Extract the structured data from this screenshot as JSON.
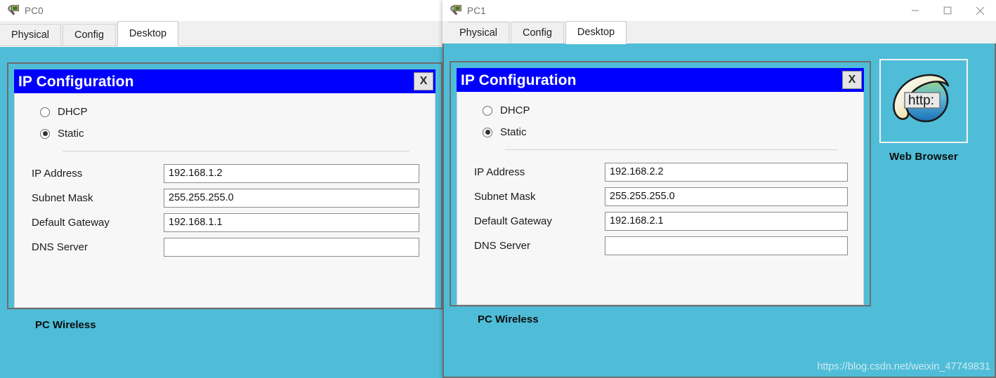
{
  "windows": [
    {
      "id": "pc0",
      "title": "PC0",
      "icon": "pc-device-icon",
      "tabs": [
        {
          "label": "Physical",
          "active": false
        },
        {
          "label": "Config",
          "active": false
        },
        {
          "label": "Desktop",
          "active": true
        }
      ],
      "dialog": {
        "title": "IP Configuration",
        "close_label": "X",
        "radios": [
          {
            "label": "DHCP",
            "checked": false
          },
          {
            "label": "Static",
            "checked": true
          }
        ],
        "fields": [
          {
            "label": "IP Address",
            "value": "192.168.1.2"
          },
          {
            "label": "Subnet Mask",
            "value": "255.255.255.0"
          },
          {
            "label": "Default Gateway",
            "value": "192.168.1.1"
          },
          {
            "label": "DNS Server",
            "value": ""
          }
        ]
      },
      "desktop_items": {
        "pc_wireless_label": "PC Wireless"
      }
    },
    {
      "id": "pc1",
      "title": "PC1",
      "icon": "pc-device-icon",
      "window_controls": {
        "minimize": "minimize-icon",
        "maximize": "maximize-icon",
        "close": "close-icon"
      },
      "tabs": [
        {
          "label": "Physical",
          "active": false
        },
        {
          "label": "Config",
          "active": false
        },
        {
          "label": "Desktop",
          "active": true
        }
      ],
      "dialog": {
        "title": "IP Configuration",
        "close_label": "X",
        "radios": [
          {
            "label": "DHCP",
            "checked": false
          },
          {
            "label": "Static",
            "checked": true
          }
        ],
        "fields": [
          {
            "label": "IP Address",
            "value": "192.168.2.2"
          },
          {
            "label": "Subnet Mask",
            "value": "255.255.255.0"
          },
          {
            "label": "Default Gateway",
            "value": "192.168.2.1"
          },
          {
            "label": "DNS Server",
            "value": ""
          }
        ]
      },
      "desktop_items": {
        "pc_wireless_label": "PC Wireless",
        "web_browser_label": "Web Browser",
        "web_browser_icon_text": "http:"
      }
    }
  ],
  "watermark": "https://blog.csdn.net/weixin_47749831",
  "colors": {
    "desktop_teal": "#4fbdd8",
    "dialog_titlebar_blue": "#0000ff",
    "tab_active_bg": "#ffffff",
    "tab_inactive_bg": "#f0f0f0",
    "window_border": "#6d6d6d"
  }
}
